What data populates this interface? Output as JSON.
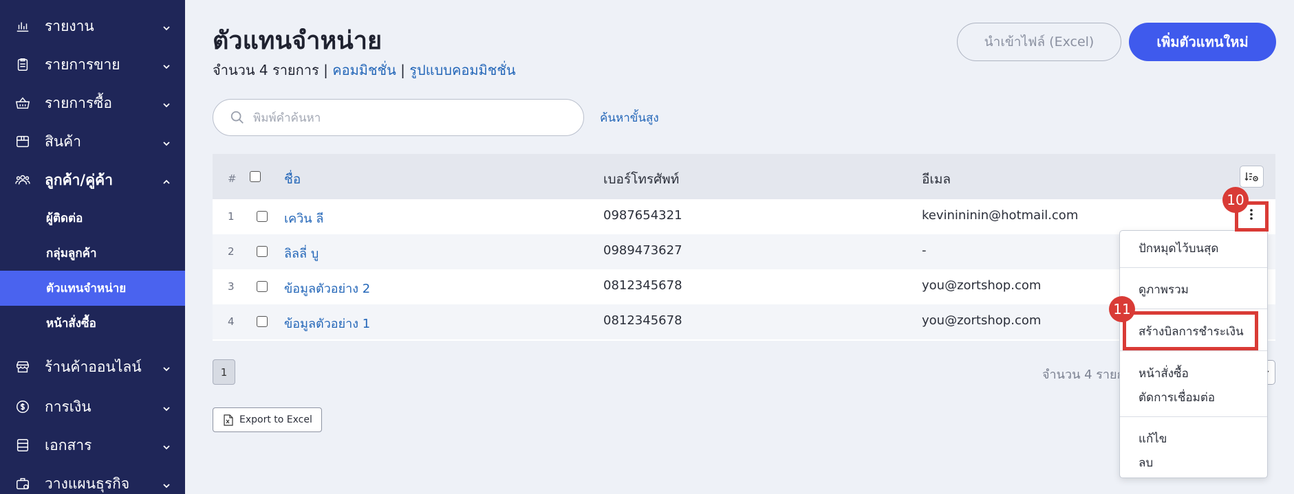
{
  "sidebar": {
    "items": [
      {
        "label": "รายงาน",
        "icon": "bar-chart-icon"
      },
      {
        "label": "รายการขาย",
        "icon": "clipboard-icon"
      },
      {
        "label": "รายการซื้อ",
        "icon": "basket-icon"
      },
      {
        "label": "สินค้า",
        "icon": "box-icon"
      },
      {
        "label": "ลูกค้า/คู่ค้า",
        "icon": "users-icon"
      },
      {
        "label": "ร้านค้าออนไลน์",
        "icon": "store-icon"
      },
      {
        "label": "การเงิน",
        "icon": "coin-icon"
      },
      {
        "label": "เอกสาร",
        "icon": "document-icon"
      },
      {
        "label": "วางแผนธุรกิจ",
        "icon": "briefcase-icon"
      }
    ],
    "sub_items": [
      {
        "label": "ผู้ติดต่อ"
      },
      {
        "label": "กลุ่มลูกค้า"
      },
      {
        "label": "ตัวแทนจำหน่าย"
      },
      {
        "label": "หน้าสั่งซื้อ"
      }
    ]
  },
  "header": {
    "title": "ตัวแทนจำหน่าย",
    "count_label": "จำนวน 4 รายการ",
    "separator": "|",
    "commission_link": "คอมมิชชั่น",
    "commission_format_link": "รูปแบบคอมมิชชั่น",
    "import_button": "นำเข้าไฟล์ (Excel)",
    "add_button": "เพิ่มตัวแทนใหม่"
  },
  "search": {
    "placeholder": "พิมพ์คำค้นหา",
    "advanced_link": "ค้นหาขั้นสูง"
  },
  "table": {
    "headers": {
      "index": "#",
      "name": "ชื่อ",
      "phone": "เบอร์โทรศัพท์",
      "email": "อีเมล"
    },
    "rows": [
      {
        "num": "1",
        "name": "เควิน ลี",
        "phone": "0987654321",
        "email": "kevinininin@hotmail.com"
      },
      {
        "num": "2",
        "name": "ลิลลี่ บู",
        "phone": "0989473627",
        "email": "-"
      },
      {
        "num": "3",
        "name": "ข้อมูลตัวอย่าง 2",
        "phone": "0812345678",
        "email": "you@zortshop.com"
      },
      {
        "num": "4",
        "name": "ข้อมูลตัวอย่าง 1",
        "phone": "0812345678",
        "email": "you@zortshop.com"
      }
    ]
  },
  "pagination": {
    "current_page": "1",
    "count_text": "จำนวน 4 รายการ"
  },
  "export_button": "Export to Excel",
  "context_menu": {
    "pin_top": "ปักหมุดไว้บนสุด",
    "overview": "ดูภาพรวม",
    "create_bill": "สร้างบิลการชำระเงิน",
    "order_page": "หน้าสั่งซื้อ",
    "disconnect": "ตัดการเชื่อมต่อ",
    "edit": "แก้ไข",
    "delete": "ลบ"
  },
  "annotations": {
    "step_10": "10",
    "step_11": "11",
    "color": "#d93b36"
  },
  "colors": {
    "sidebar_bg": "#1f2658",
    "accent": "#3f5aed",
    "link": "#2366b8"
  }
}
